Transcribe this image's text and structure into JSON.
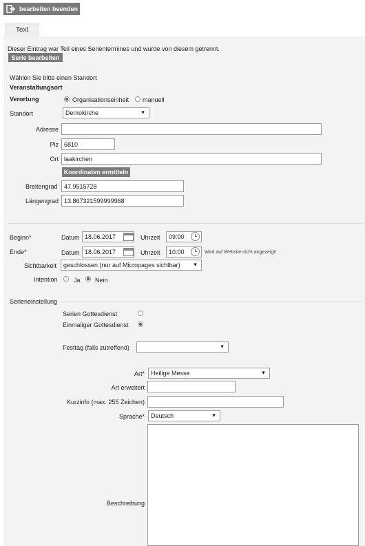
{
  "toolbar": {
    "end_edit_label": "bearbeiten beenden"
  },
  "tabs": [
    {
      "label": "Text"
    }
  ],
  "notice": {
    "text": "Dieser Eintrag war Teil eines Serientermines und wurde von diesem getrennt.",
    "series_button": "Serie bearbeiten"
  },
  "location": {
    "prompt": "Wählen Sie bitte einen Standort",
    "heading": "Veranstaltungsort",
    "verortung_label": "Verortung",
    "option_org": "Organisationseinheit",
    "option_manual": "manuell",
    "standort_label": "Standort",
    "standort_value": "Demokirche",
    "adresse_label": "Adresse",
    "adresse_value": "",
    "plz_label": "Plz",
    "plz_value": "6810",
    "ort_label": "Ort",
    "ort_value": "laakirchen",
    "coords_button": "Koordinaten ermitteln",
    "breitengrad_label": "Breitengrad",
    "breitengrad_value": "47.9515728",
    "laengengrad_label": "Längengrad",
    "laengengrad_value": "13.867321599999968"
  },
  "schedule": {
    "begin_label": "Beginn*",
    "end_label": "Ende*",
    "datum_label": "Datum",
    "uhrzeit_label": "Uhrzeit",
    "begin_date": "18.06.2017",
    "begin_time": "09:00",
    "end_date": "18.06.2017",
    "end_time": "10:00",
    "end_note": "Wird auf Website nicht angezeigt!",
    "visibility_label": "Sichtbarkeit",
    "visibility_value": "geschlossen (nur auf Micropages sichtbar)",
    "intention_label": "Intention",
    "intention_yes": "Ja",
    "intention_no": "Nein"
  },
  "series": {
    "heading": "Serieneinstellung",
    "option_series": "Serien Gottesdienst",
    "option_single": "Einmaliger Gottesdienst",
    "festtag_label": "Festtag (falls zutreffend)",
    "festtag_value": ""
  },
  "details": {
    "art_label": "Art*",
    "art_value": "Heilige Messe",
    "art_ext_label": "Art erweitert",
    "art_ext_value": "",
    "kurzinfo_label": "Kurzinfo (max. 255 Zeichen)",
    "kurzinfo_value": "",
    "sprache_label": "Sprache*",
    "sprache_value": "Deutsch",
    "beschreibung_label": "Beschreibung",
    "beschreibung_value": ""
  }
}
